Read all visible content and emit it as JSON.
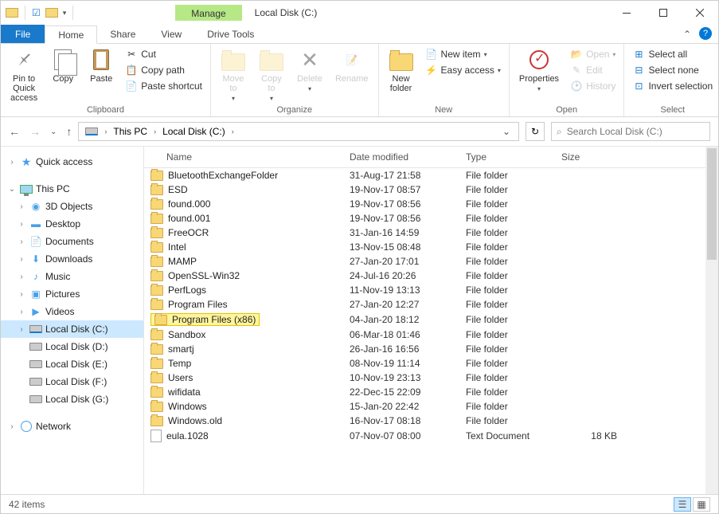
{
  "title": "Local Disk (C:)",
  "manage_tab": "Manage",
  "tabs": {
    "file": "File",
    "home": "Home",
    "share": "Share",
    "view": "View",
    "drive_tools": "Drive Tools"
  },
  "ribbon": {
    "clipboard": {
      "label": "Clipboard",
      "pin": "Pin to Quick\naccess",
      "copy": "Copy",
      "paste": "Paste",
      "cut": "Cut",
      "copy_path": "Copy path",
      "paste_shortcut": "Paste shortcut"
    },
    "organize": {
      "label": "Organize",
      "move_to": "Move\nto",
      "copy_to": "Copy\nto",
      "delete": "Delete",
      "rename": "Rename"
    },
    "new": {
      "label": "New",
      "new_folder": "New\nfolder",
      "new_item": "New item",
      "easy_access": "Easy access"
    },
    "open": {
      "label": "Open",
      "properties": "Properties",
      "open": "Open",
      "edit": "Edit",
      "history": "History"
    },
    "select": {
      "label": "Select",
      "select_all": "Select all",
      "select_none": "Select none",
      "invert": "Invert selection"
    }
  },
  "breadcrumb": {
    "this_pc": "This PC",
    "drive": "Local Disk (C:)"
  },
  "search_placeholder": "Search Local Disk (C:)",
  "tree": {
    "quick_access": "Quick access",
    "this_pc": "This PC",
    "objects3d": "3D Objects",
    "desktop": "Desktop",
    "documents": "Documents",
    "downloads": "Downloads",
    "music": "Music",
    "pictures": "Pictures",
    "videos": "Videos",
    "drive_c": "Local Disk (C:)",
    "drive_d": "Local Disk (D:)",
    "drive_e": "Local Disk (E:)",
    "drive_f": "Local Disk (F:)",
    "drive_g": "Local Disk (G:)",
    "network": "Network"
  },
  "columns": {
    "name": "Name",
    "date": "Date modified",
    "type": "Type",
    "size": "Size"
  },
  "files": [
    {
      "name": "BluetoothExchangeFolder",
      "date": "31-Aug-17 21:58",
      "type": "File folder",
      "size": "",
      "icon": "folder"
    },
    {
      "name": "ESD",
      "date": "19-Nov-17 08:57",
      "type": "File folder",
      "size": "",
      "icon": "folder"
    },
    {
      "name": "found.000",
      "date": "19-Nov-17 08:56",
      "type": "File folder",
      "size": "",
      "icon": "folder"
    },
    {
      "name": "found.001",
      "date": "19-Nov-17 08:56",
      "type": "File folder",
      "size": "",
      "icon": "folder"
    },
    {
      "name": "FreeOCR",
      "date": "31-Jan-16 14:59",
      "type": "File folder",
      "size": "",
      "icon": "folder"
    },
    {
      "name": "Intel",
      "date": "13-Nov-15 08:48",
      "type": "File folder",
      "size": "",
      "icon": "folder"
    },
    {
      "name": "MAMP",
      "date": "27-Jan-20 17:01",
      "type": "File folder",
      "size": "",
      "icon": "folder"
    },
    {
      "name": "OpenSSL-Win32",
      "date": "24-Jul-16 20:26",
      "type": "File folder",
      "size": "",
      "icon": "folder"
    },
    {
      "name": "PerfLogs",
      "date": "11-Nov-19 13:13",
      "type": "File folder",
      "size": "",
      "icon": "folder"
    },
    {
      "name": "Program Files",
      "date": "27-Jan-20 12:27",
      "type": "File folder",
      "size": "",
      "icon": "folder"
    },
    {
      "name": "Program Files (x86)",
      "date": "04-Jan-20 18:12",
      "type": "File folder",
      "size": "",
      "icon": "folder",
      "highlighted": true
    },
    {
      "name": "Sandbox",
      "date": "06-Mar-18 01:46",
      "type": "File folder",
      "size": "",
      "icon": "folder"
    },
    {
      "name": "smartj",
      "date": "26-Jan-16 16:56",
      "type": "File folder",
      "size": "",
      "icon": "folder"
    },
    {
      "name": "Temp",
      "date": "08-Nov-19 11:14",
      "type": "File folder",
      "size": "",
      "icon": "folder"
    },
    {
      "name": "Users",
      "date": "10-Nov-19 23:13",
      "type": "File folder",
      "size": "",
      "icon": "folder"
    },
    {
      "name": "wifidata",
      "date": "22-Dec-15 22:09",
      "type": "File folder",
      "size": "",
      "icon": "folder"
    },
    {
      "name": "Windows",
      "date": "15-Jan-20 22:42",
      "type": "File folder",
      "size": "",
      "icon": "folder"
    },
    {
      "name": "Windows.old",
      "date": "16-Nov-17 08:18",
      "type": "File folder",
      "size": "",
      "icon": "folder"
    },
    {
      "name": "eula.1028",
      "date": "07-Nov-07 08:00",
      "type": "Text Document",
      "size": "18 KB",
      "icon": "file"
    }
  ],
  "status": "42 items"
}
